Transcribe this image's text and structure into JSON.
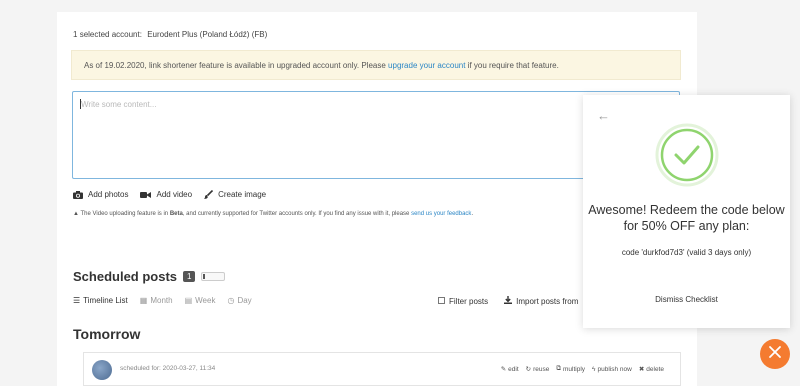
{
  "account": {
    "count": "1",
    "label": "selected account:",
    "name": "Eurodent Plus (Poland Łódź) (FB)"
  },
  "notice": {
    "before": "As of 19.02.2020, link shortener feature is available in upgraded account only. Please ",
    "link": "upgrade your account",
    "after": " if you require that feature."
  },
  "editor": {
    "placeholder": "Write some content..."
  },
  "tools": {
    "add_photos": "Add photos",
    "add_video": "Add video",
    "create_image": "Create image"
  },
  "warning": {
    "before": "The Video uploading feature is in ",
    "beta": "Beta",
    "middle": ", and currently supported for Twitter accounts only. If you find any issue with it, please ",
    "link": "send us your feedback",
    "after": "."
  },
  "scheduled": {
    "title": "Scheduled posts",
    "count": "1"
  },
  "views": {
    "timeline": "Timeline List",
    "month": "Month",
    "week": "Week",
    "day": "Day"
  },
  "actions": {
    "filter": "Filter posts",
    "import": "Import posts from"
  },
  "day_heading": "Tomorrow",
  "post": {
    "scheduled_for": "scheduled for: 2020-03-27, 11:34",
    "edit": "edit",
    "reuse": "reuse",
    "multiply": "multiply",
    "publish_now": "publish now",
    "delete": "delete"
  },
  "popup": {
    "headline": "Awesome! Redeem the code below for 50% OFF any plan:",
    "code_text": "code 'durkfod7d3' (valid 3 days only)",
    "dismiss": "Dismiss Checklist"
  },
  "colors": {
    "accent": "#2b86c5",
    "success": "#8fd46e",
    "fab": "#f47b30",
    "notice_bg": "#fbf6e2"
  }
}
